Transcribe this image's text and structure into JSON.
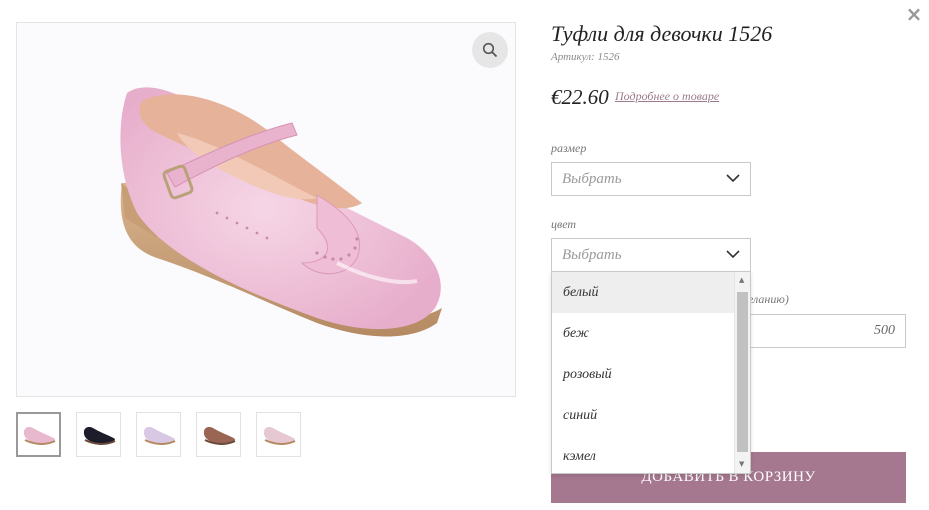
{
  "modal": {
    "close_icon": "close-icon"
  },
  "gallery": {
    "zoom_icon": "zoom-icon",
    "thumbnails": [
      {
        "color": "#e8b8cf"
      },
      {
        "color": "#1c1c2a"
      },
      {
        "color": "#d9c8e4"
      },
      {
        "color": "#9a6553"
      },
      {
        "color": "#e6c8d2"
      }
    ]
  },
  "product": {
    "title": "Туфли для девочки 1526",
    "sku": "Артикул: 1526",
    "price": "€22.60",
    "more_link": "Подробнее о товаре"
  },
  "options": {
    "size_label": "размер",
    "size_value": "Выбрать",
    "color_label": "цвет",
    "color_value": "Выбрать",
    "color_options": [
      "белый",
      "беж",
      "розовый",
      "синий",
      "кэмел"
    ],
    "highlighted_option": "белый"
  },
  "gift": {
    "label_partial": "желанию)",
    "amount": "500"
  },
  "cart": {
    "add_label": "ДОБАВИТЬ В КОРЗИНУ"
  },
  "colors": {
    "accent": "#a6788f",
    "link": "#9b7a8e",
    "shoe_pink": "#f0c2d8"
  }
}
